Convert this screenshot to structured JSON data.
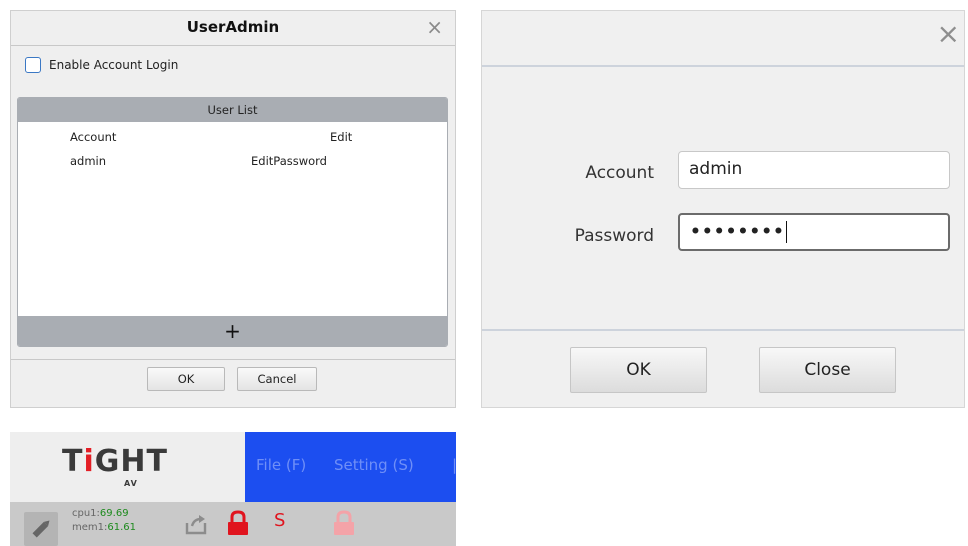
{
  "useradmin": {
    "title": "UserAdmin",
    "close_glyph": "×",
    "enable_login_label": "Enable Account Login",
    "user_list": {
      "header": "User List",
      "columns": [
        "Account",
        "Edit"
      ],
      "rows": [
        {
          "account": "admin",
          "edit": "EditPassword"
        }
      ],
      "add_glyph": "+"
    },
    "ok_label": "OK",
    "cancel_label": "Cancel"
  },
  "login": {
    "close_glyph": "×",
    "account_label": "Account",
    "account_value": "admin",
    "password_label": "Password",
    "password_mask": "••••••••",
    "ok_label": "OK",
    "close_label": "Close"
  },
  "app": {
    "logo_text_a": "T",
    "logo_text_i": "i",
    "logo_text_b": "GHT",
    "logo_sub": "AV",
    "menu": [
      "File (F)",
      "Setting (S)"
    ],
    "status": {
      "cpu_label": "cpu1:",
      "cpu_value": "69.69",
      "mem_label": "mem1:",
      "mem_value": "61.61",
      "s_glyph": "S"
    },
    "colors": {
      "menubar": "#1c4ef0",
      "lock_red": "#e0141e",
      "lock_pink": "#f4a3a8",
      "s_red": "#e0141e"
    }
  }
}
